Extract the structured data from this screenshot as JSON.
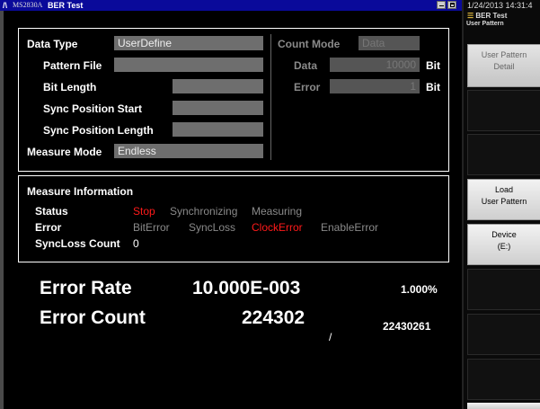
{
  "titlebar": {
    "model": "MS2830A",
    "app_title": "BER Test"
  },
  "setup": {
    "data_type": {
      "label": "Data Type",
      "value": "UserDefine"
    },
    "pattern_file": {
      "label": "Pattern File",
      "value": ""
    },
    "bit_length": {
      "label": "Bit Length",
      "value": ""
    },
    "sync_position_start": {
      "label": "Sync Position Start",
      "value": ""
    },
    "sync_position_length": {
      "label": "Sync Position Length",
      "value": ""
    },
    "measure_mode": {
      "label": "Measure Mode",
      "value": "Endless"
    },
    "count_mode": {
      "label": "Count Mode",
      "value": "Data"
    },
    "data": {
      "label": "Data",
      "value": "10000",
      "unit": "Bit"
    },
    "error": {
      "label": "Error",
      "value": "1",
      "unit": "Bit"
    }
  },
  "measure_info": {
    "title": "Measure Information",
    "status": {
      "label": "Status",
      "items": [
        "Stop",
        "Synchronizing",
        "Measuring"
      ],
      "active": "Stop"
    },
    "error": {
      "label": "Error",
      "items": [
        "BitError",
        "SyncLoss",
        "ClockError",
        "EnableError"
      ],
      "active": "ClockError"
    },
    "syncloss_count": {
      "label": "SyncLoss Count",
      "value": "0"
    }
  },
  "results": {
    "error_rate_label": "Error Rate",
    "error_rate_value": "10.000E-003",
    "error_rate_percent": "1.000%",
    "error_count_label": "Error Count",
    "error_count_value": "224302",
    "separator": "/",
    "total_count": "22430261"
  },
  "sidebar": {
    "datetime": "1/24/2013 14:31:4",
    "header_title": "BER Test",
    "header_subtitle": "User Pattern",
    "buttons": {
      "user_pattern_detail": {
        "line1": "User Pattern",
        "line2": "Detail"
      },
      "load_user_pattern": {
        "line1": "Load",
        "line2": "User Pattern"
      },
      "device": {
        "line1": "Device",
        "line2": "(E:)"
      }
    }
  },
  "colors": {
    "title_bar": "#0a0a9a",
    "active_status": "#ff1a1a",
    "field_bg": "#6e6e6e"
  }
}
